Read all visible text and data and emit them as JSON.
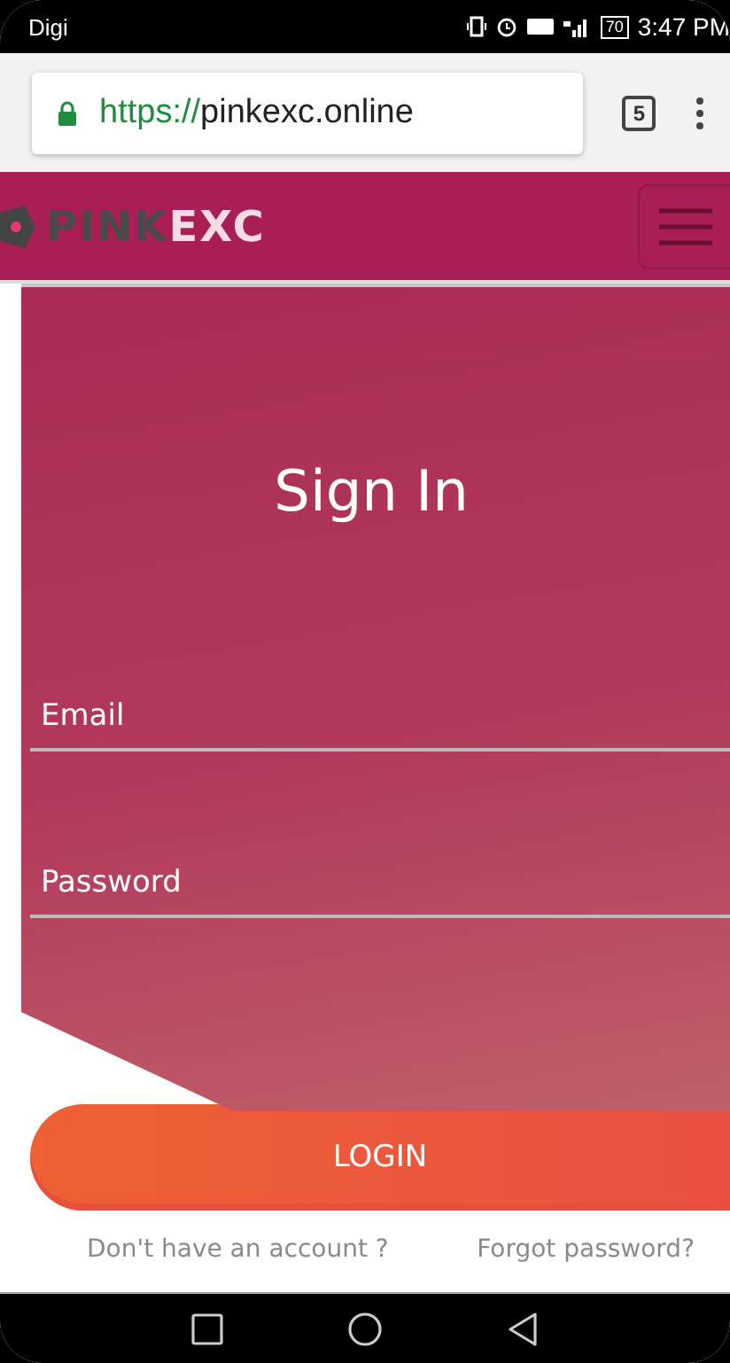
{
  "status_bar": {
    "carrier": "Digi",
    "battery": "70",
    "time": "3:47 PM"
  },
  "browser": {
    "url_scheme": "https://",
    "url_host": "pinkexc.online",
    "tab_count": "5"
  },
  "header": {
    "logo_dark": "PINK",
    "logo_light": "EXC"
  },
  "form": {
    "title": "Sign In",
    "fields": [
      {
        "placeholder": "Email"
      },
      {
        "placeholder": "Password"
      }
    ],
    "login_button": "LOGIN",
    "links": [
      "Don't have an account ?",
      "Forgot password?"
    ]
  }
}
